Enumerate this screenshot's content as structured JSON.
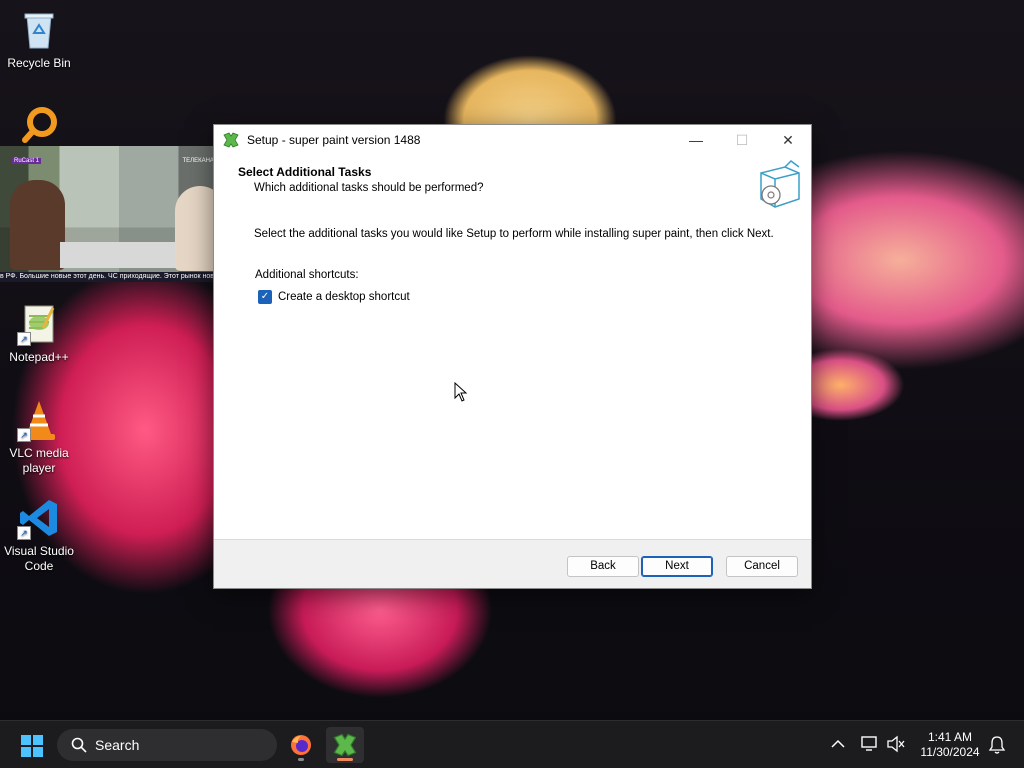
{
  "desktop": {
    "icons": [
      {
        "label": "Recycle Bin"
      },
      {
        "label": "Notepad++"
      },
      {
        "label": "VLC media player"
      },
      {
        "label": "Visual Studio Code"
      }
    ]
  },
  "video_overlay": {
    "ticker_text": "в РФ. Большие новые этот день. ЧС приходящие. Этот рынок нового. Этапы банк. КРС",
    "logo_left": "RuCast 1",
    "logo_right": "ТЕЛЕКАНАЛ"
  },
  "window": {
    "title": "Setup - super paint version 1488",
    "heading": "Select Additional Tasks",
    "subheading": "Which additional tasks should be performed?",
    "description": "Select the additional tasks you would like Setup to perform while installing super paint, then click Next.",
    "group_label": "Additional shortcuts:",
    "checkbox_label": "Create a desktop shortcut",
    "checkbox_checked": true,
    "buttons": {
      "back": "Back",
      "next": "Next",
      "cancel": "Cancel"
    },
    "controls": {
      "minimize": "—",
      "maximize": "☐",
      "close": "✕"
    }
  },
  "taskbar": {
    "search_label": "Search",
    "time": "1:41 AM",
    "date": "11/30/2024"
  },
  "colors": {
    "accent": "#1b62b8",
    "taskbar": "#1c1c1e"
  }
}
